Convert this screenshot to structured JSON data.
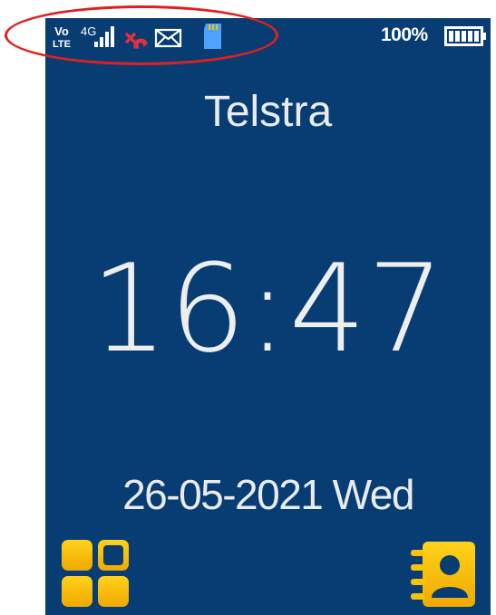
{
  "status_bar": {
    "icons": [
      "volte-icon",
      "4g-icon",
      "signal-strength-icon",
      "missed-call-icon",
      "message-envelope-icon",
      "sd-card-icon",
      "battery-icon"
    ],
    "volte_top": "Vo",
    "volte_bottom": "LTE",
    "network_type": "4G",
    "battery_percent": "100%",
    "battery_level": 1.0
  },
  "home": {
    "carrier": "Telstra",
    "time": "16:47",
    "date": "26-05-2021 Wed"
  },
  "softkeys": {
    "left_icon": "menu-grid-icon",
    "right_icon": "contacts-icon"
  },
  "colors": {
    "screen_background": "#083d74",
    "text": "#e9ecef",
    "accent_yellow": "#f6c400",
    "missed_call_red": "#e0303a",
    "sd_card_blue": "#4da3ff",
    "annotation_red": "#e02020"
  }
}
